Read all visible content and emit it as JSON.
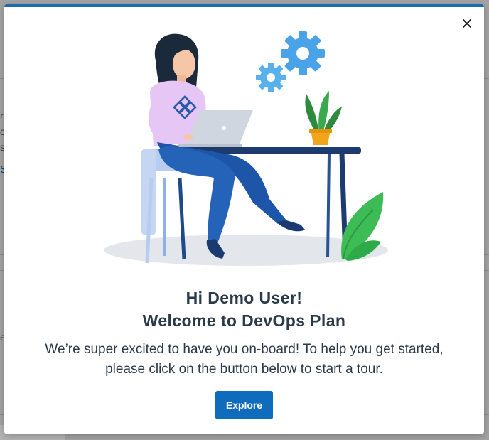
{
  "background": {
    "fragments": [
      {
        "text": "re",
        "link": false
      },
      {
        "text": "o",
        "link": false
      },
      {
        "text": "s",
        "link": false
      },
      {
        "text": "S",
        "link": true
      },
      {
        "text": "el",
        "link": false
      }
    ]
  },
  "modal": {
    "close_icon": "close-icon",
    "title_line1": "Hi Demo User!",
    "title_line2": "Welcome to DevOps Plan",
    "message": "We’re super excited to have you on-board! To help you get started, please click on the button below to start a tour.",
    "explore_label": "Explore",
    "accent_color": "#0f6cbd"
  }
}
